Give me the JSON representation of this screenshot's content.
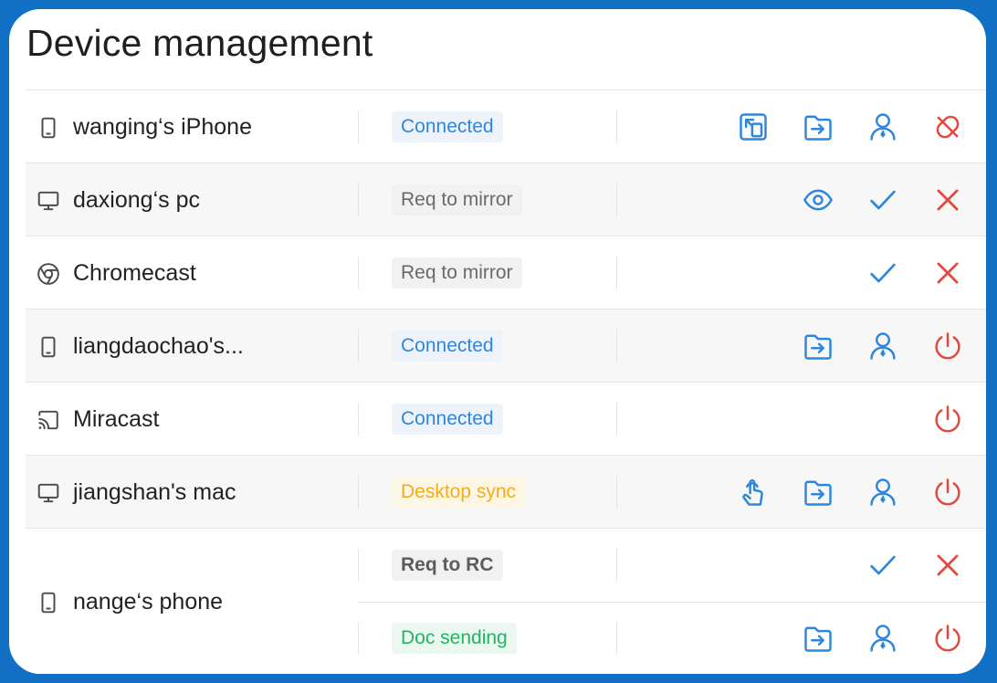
{
  "title": "Device management",
  "colors": {
    "frame": "#1270c4",
    "connected": "#2f86dc",
    "desktop_sync": "#f4ac1a",
    "doc_sending": "#22b463",
    "danger": "#e2483b"
  },
  "devices": [
    {
      "name": "wanging‘s iPhone",
      "icon": "phone-icon",
      "status": "Connected",
      "actions": [
        "screen-mirror-icon",
        "send-file-icon",
        "user-icon",
        "disconnect-icon"
      ]
    },
    {
      "name": "daxiong‘s pc",
      "icon": "monitor-icon",
      "status": "Req to mirror",
      "actions": [
        "eye-icon",
        "check-icon",
        "close-icon"
      ]
    },
    {
      "name": "Chromecast",
      "icon": "chrome-icon",
      "status": "Req to mirror",
      "actions": [
        "check-icon",
        "close-icon"
      ]
    },
    {
      "name": "liangdaochao's...",
      "icon": "phone-icon",
      "status": "Connected",
      "actions": [
        "send-file-icon",
        "user-icon",
        "power-icon"
      ]
    },
    {
      "name": "Miracast",
      "icon": "cast-icon",
      "status": "Connected",
      "actions": [
        "power-icon"
      ]
    },
    {
      "name": "jiangshan's mac",
      "icon": "monitor-icon",
      "status": "Desktop sync",
      "actions": [
        "touch-icon",
        "send-file-icon",
        "user-icon",
        "power-icon"
      ]
    },
    {
      "name": "nange‘s phone",
      "icon": "phone-icon",
      "sessions": [
        {
          "status": "Req to RC",
          "actions": [
            "check-icon",
            "close-icon"
          ]
        },
        {
          "status": "Doc sending",
          "actions": [
            "send-file-icon",
            "user-icon",
            "power-icon"
          ]
        }
      ]
    }
  ]
}
